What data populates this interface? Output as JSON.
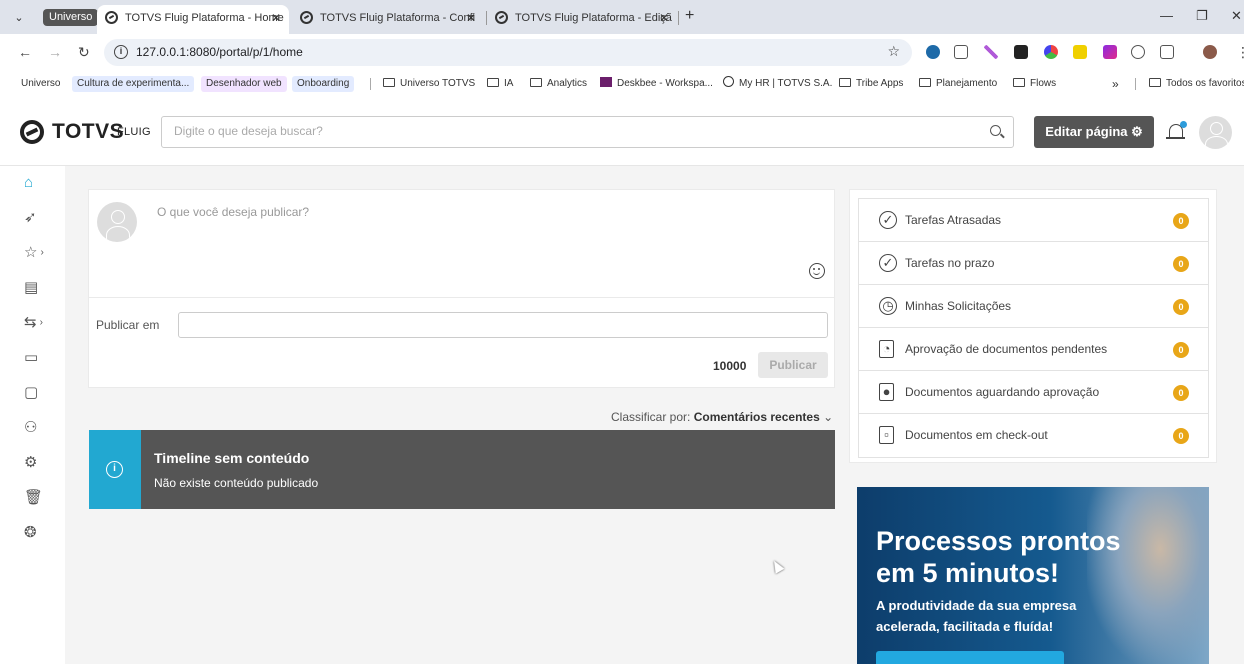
{
  "browser": {
    "group_chip": "Universo",
    "tabs": [
      {
        "title": "TOTVS Fluig Plataforma - Home"
      },
      {
        "title": "TOTVS Fluig Plataforma - Confi"
      },
      {
        "title": "TOTVS Fluig Plataforma - Ediçã"
      }
    ],
    "url": "127.0.0.1:8080/portal/p/1/home",
    "bookmarks": [
      {
        "label": "Universo"
      },
      {
        "label": "Cultura de experimenta..."
      },
      {
        "label": "Desenhador web"
      },
      {
        "label": "Onboarding"
      },
      {
        "label": "Universo TOTVS"
      },
      {
        "label": "IA"
      },
      {
        "label": "Analytics"
      },
      {
        "label": "Deskbee - Workspa..."
      },
      {
        "label": "My HR | TOTVS S.A."
      },
      {
        "label": "Tribe Apps"
      },
      {
        "label": "Planejamento"
      },
      {
        "label": "Flows"
      },
      {
        "label": "Todos os favoritos"
      }
    ],
    "overflow": "»"
  },
  "header": {
    "logo_text": "TOTVS",
    "logo_sub": "FLUIG",
    "search_placeholder": "Digite o que deseja buscar?",
    "edit_label": "Editar página ⚙"
  },
  "publish": {
    "placeholder": "O que você deseja publicar?",
    "where_label": "Publicar em",
    "counter": "10000",
    "button": "Publicar"
  },
  "sort": {
    "label": "Classificar por:",
    "value": "Comentários recentes"
  },
  "timeline": {
    "title": "Timeline sem conteúdo",
    "desc": "Não existe conteúdo publicado"
  },
  "tasks": [
    {
      "label": "Tarefas Atrasadas",
      "count": "0"
    },
    {
      "label": "Tarefas no prazo",
      "count": "0"
    },
    {
      "label": "Minhas Solicitações",
      "count": "0"
    },
    {
      "label": "Aprovação de documentos pendentes",
      "count": "0"
    },
    {
      "label": "Documentos aguardando aprovação",
      "count": "0"
    },
    {
      "label": "Documentos em check-out",
      "count": "0"
    }
  ],
  "banner": {
    "title_line1": "Processos prontos",
    "title_line2": "em 5 minutos!",
    "sub_line1": "A produtividade da sua empresa",
    "sub_line2": "acelerada, facilitada e fluída!"
  },
  "colors": {
    "accent": "#22a8d1",
    "badge": "#e8a618",
    "dark": "#555555"
  }
}
